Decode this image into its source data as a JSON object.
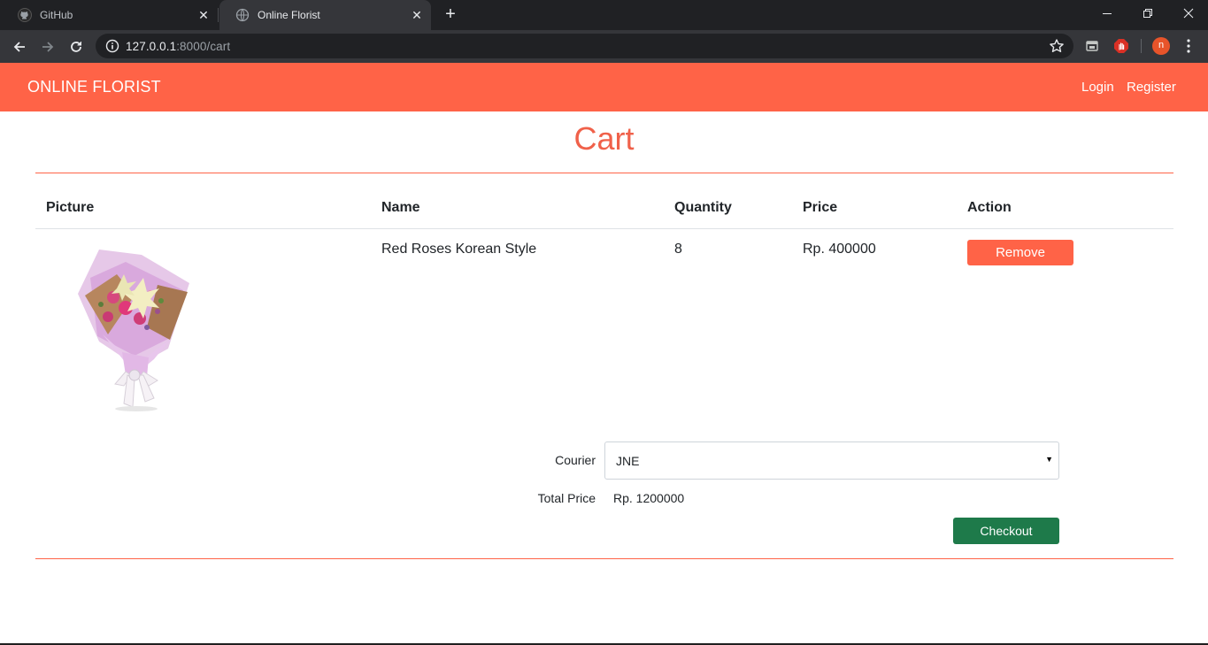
{
  "browser": {
    "tabs": [
      {
        "title": "GitHub",
        "icon": "github-icon"
      },
      {
        "title": "Online Florist",
        "icon": "globe-icon"
      }
    ],
    "close_glyph": "✕",
    "new_tab_glyph": "+",
    "url_host": "127.0.0.1",
    "url_path": ":8000/cart",
    "avatar_letter": "n"
  },
  "site": {
    "brand": "ONLINE FLORIST",
    "nav": {
      "login": "Login",
      "register": "Register"
    },
    "accent_color": "#ff6347"
  },
  "cart": {
    "title": "Cart",
    "columns": [
      "Picture",
      "Name",
      "Quantity",
      "Price",
      "Action"
    ],
    "items": [
      {
        "name": "Red Roses Korean Style",
        "quantity": "8",
        "price": "Rp. 400000",
        "action": "Remove"
      }
    ],
    "courier": {
      "label": "Courier",
      "selected": "JNE"
    },
    "total": {
      "label": "Total Price",
      "value": "Rp. 1200000"
    },
    "checkout_label": "Checkout",
    "checkout_color": "#1e7a4a"
  }
}
